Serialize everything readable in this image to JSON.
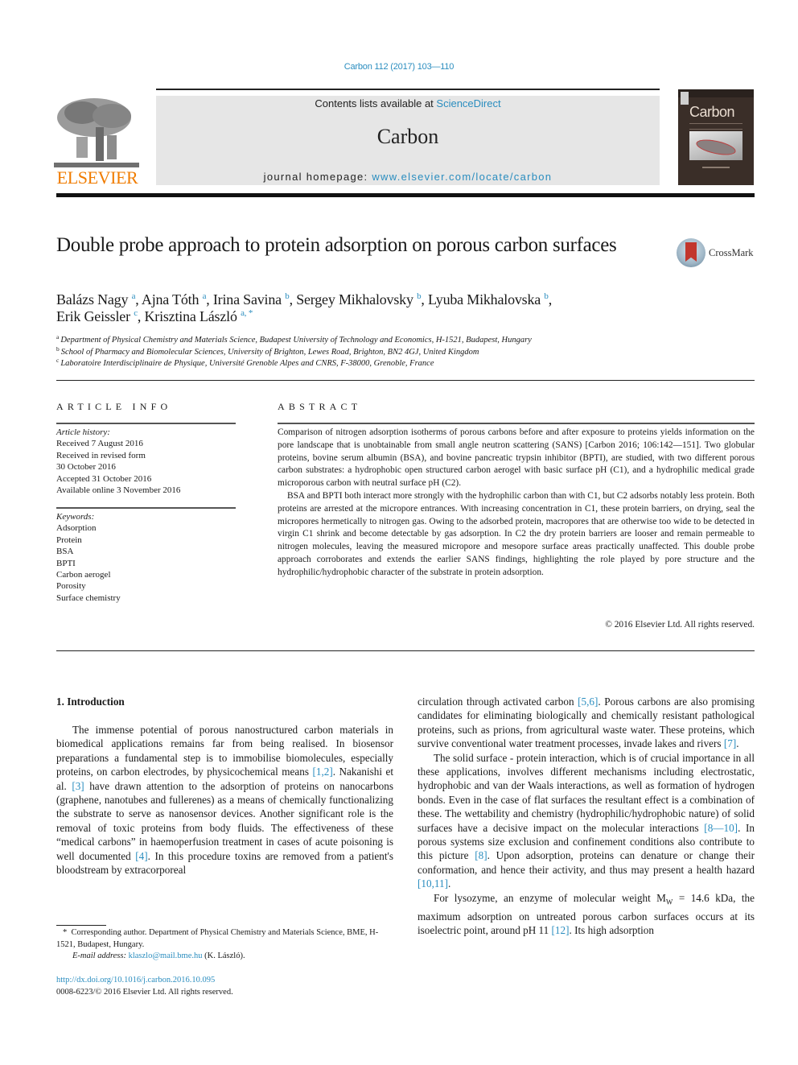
{
  "header": {
    "citation": "Carbon 112 (2017) 103—110",
    "contents_prefix": "Contents lists available at ",
    "contents_link": "ScienceDirect",
    "journal_name": "Carbon",
    "homepage_prefix": "journal homepage: ",
    "homepage_link": "www.elsevier.com/locate/carbon",
    "publisher": "ELSEVIER",
    "cover_title": "Carbon"
  },
  "crossmark": {
    "label": "CrossMark"
  },
  "article": {
    "title": "Double probe approach to protein adsorption on porous carbon surfaces",
    "authors": [
      {
        "name": "Balázs Nagy",
        "aff": "a"
      },
      {
        "name": "Ajna Tóth",
        "aff": "a"
      },
      {
        "name": "Irina Savina",
        "aff": "b"
      },
      {
        "name": "Sergey Mikhalovsky",
        "aff": "b"
      },
      {
        "name": "Lyuba Mikhalovska",
        "aff": "b"
      },
      {
        "name": "Erik Geissler",
        "aff": "c"
      },
      {
        "name": "Krisztina László",
        "aff": "a, *"
      }
    ],
    "affiliations": [
      {
        "mark": "a",
        "text": "Department of Physical Chemistry and Materials Science, Budapest University of Technology and Economics, H-1521, Budapest, Hungary"
      },
      {
        "mark": "b",
        "text": "School of Pharmacy and Biomolecular Sciences, University of Brighton, Lewes Road, Brighton, BN2 4GJ, United Kingdom"
      },
      {
        "mark": "c",
        "text": "Laboratoire Interdisciplinaire de Physique, Université Grenoble Alpes and CNRS, F-38000, Grenoble, France"
      }
    ]
  },
  "article_info": {
    "heading": "ARTICLE INFO",
    "history_heading": "Article history:",
    "history": [
      "Received 7 August 2016",
      "Received in revised form",
      "30 October 2016",
      "Accepted 31 October 2016",
      "Available online 3 November 2016"
    ],
    "keywords_heading": "Keywords:",
    "keywords": [
      "Adsorption",
      "Protein",
      "BSA",
      "BPTI",
      "Carbon aerogel",
      "Porosity",
      "Surface chemistry"
    ]
  },
  "abstract": {
    "heading": "ABSTRACT",
    "paragraphs": [
      "Comparison of nitrogen adsorption isotherms of porous carbons before and after exposure to proteins yields information on the pore landscape that is unobtainable from small angle neutron scattering (SANS) [Carbon 2016; 106:142—151]. Two globular proteins, bovine serum albumin (BSA), and bovine pancreatic trypsin inhibitor (BPTI), are studied, with two different porous carbon substrates: a hydrophobic open structured carbon aerogel with basic surface pH (C1), and a hydrophilic medical grade microporous carbon with neutral surface pH (C2).",
      "BSA and BPTI both interact more strongly with the hydrophilic carbon than with C1, but C2 adsorbs notably less protein. Both proteins are arrested at the micropore entrances. With increasing concentration in C1, these protein barriers, on drying, seal the micropores hermetically to nitrogen gas. Owing to the adsorbed protein, macropores that are otherwise too wide to be detected in virgin C1 shrink and become detectable by gas adsorption. In C2 the dry protein barriers are looser and remain permeable to nitrogen molecules, leaving the measured micropore and mesopore surface areas practically unaffected. This double probe approach corroborates and extends the earlier SANS findings, highlighting the role played by pore structure and the hydrophilic/hydrophobic character of the substrate in protein adsorption."
    ],
    "copyright": "© 2016 Elsevier Ltd. All rights reserved."
  },
  "body": {
    "section_heading": "1.  Introduction",
    "left": {
      "p1_a": "The immense potential of porous nanostructured carbon materials in biomedical applications remains far from being realised. In biosensor preparations a fundamental step is to immobilise biomolecules, especially proteins, on carbon electrodes, by physicochemical means ",
      "ref1": "[1,2]",
      "p1_b": ". Nakanishi et al. ",
      "ref2": "[3]",
      "p1_c": " have drawn attention to the adsorption of proteins on nanocarbons (graphene, nanotubes and fullerenes) as a means of chemically functionalizing the substrate to serve as nanosensor devices. Another significant role is the removal of toxic proteins from body fluids. The effectiveness of these “medical carbons” in haemoperfusion treatment in cases of acute poisoning is well documented ",
      "ref3": "[4]",
      "p1_d": ". In this procedure toxins are removed from a patient's bloodstream by extracorporeal"
    },
    "right": {
      "p1_a": "circulation through activated carbon ",
      "ref1": "[5,6]",
      "p1_b": ". Porous carbons are also promising candidates for eliminating biologically and chemically resistant pathological proteins, such as prions, from agricultural waste water. These proteins, which survive conventional water treatment processes, invade lakes and rivers ",
      "ref2": "[7]",
      "p1_c": ".",
      "p2_a": "The solid surface - protein interaction, which is of crucial importance in all these applications, involves different mechanisms including electrostatic, hydrophobic and van der Waals interactions, as well as formation of hydrogen bonds. Even in the case of flat surfaces the resultant effect is a combination of these. The wettability and chemistry (hydrophilic/hydrophobic nature) of solid surfaces have a decisive impact on the molecular interactions ",
      "ref3": "[8—10]",
      "p2_b": ". In porous systems size exclusion and confinement conditions also contribute to this picture ",
      "ref4": "[8]",
      "p2_c": ". Upon adsorption, proteins can denature or change their conformation, and hence their activity, and thus may present a health hazard ",
      "ref5": "[10,11]",
      "p2_d": ".",
      "p3_a": "For lysozyme, an enzyme of molecular weight M",
      "p3_sub": "W",
      "p3_b": " = 14.6 kDa, the maximum adsorption on untreated porous carbon surfaces occurs at its isoelectric point, around pH 11 ",
      "ref6": "[12]",
      "p3_c": ". Its high adsorption"
    }
  },
  "footnotes": {
    "star": "*",
    "corresponding": "Corresponding author. Department of Physical Chemistry and Materials Science, BME, H-1521, Budapest, Hungary.",
    "email_label": "E-mail address: ",
    "email": "klaszlo@mail.bme.hu",
    "email_suffix": " (K. László).",
    "doi": "http://dx.doi.org/10.1016/j.carbon.2016.10.095",
    "issn": "0008-6223/© 2016 Elsevier Ltd. All rights reserved."
  },
  "colors": {
    "link": "#2a8dbf",
    "elsevier_orange": "#f07c00",
    "header_box": "#e6e6e6"
  }
}
